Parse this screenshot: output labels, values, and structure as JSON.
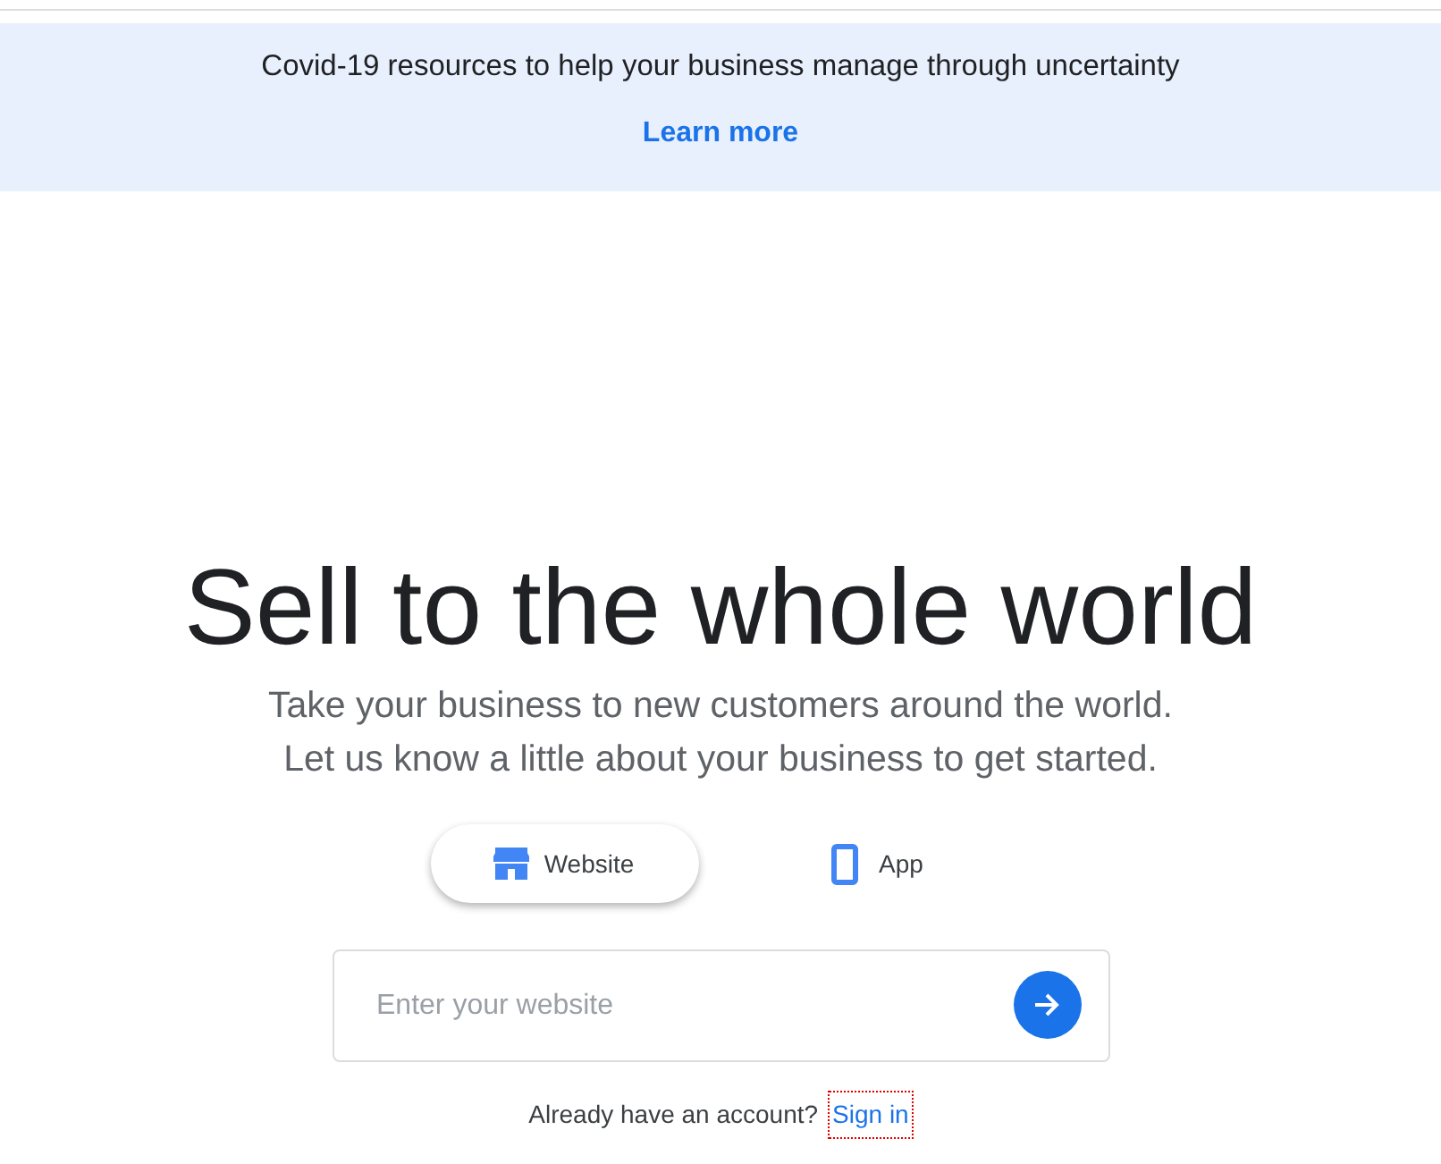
{
  "banner": {
    "message": "Covid-19 resources to help your business manage through uncertainty",
    "link": "Learn more"
  },
  "hero": {
    "title": "Sell to the whole world",
    "subtitle_lines": [
      "Take your business to new customers around the world.",
      "Let us know a little about your business to get started."
    ]
  },
  "options": [
    {
      "kind": "website",
      "label": "Website",
      "selected": true
    },
    {
      "kind": "app",
      "label": "App",
      "selected": false
    }
  ],
  "website_field": {
    "placeholder": "Enter your website"
  },
  "sign_in": {
    "prompt": "Already have an account?",
    "link": "Sign in",
    "focused": true
  }
}
